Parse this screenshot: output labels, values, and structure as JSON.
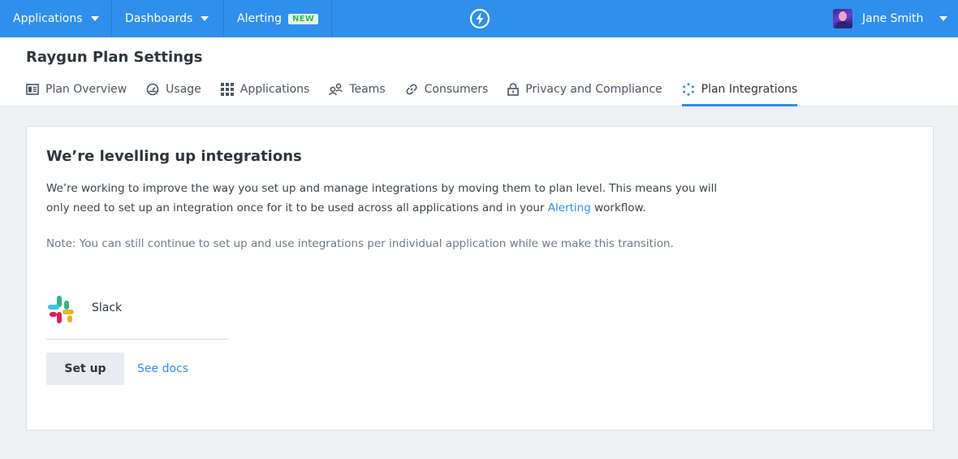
{
  "topnav": {
    "applications_label": "Applications",
    "dashboards_label": "Dashboards",
    "alerting_label": "Alerting",
    "alerting_badge": "NEW",
    "logo_icon": "lightning-bolt-icon",
    "user_name": "Jane Smith"
  },
  "header": {
    "title": "Raygun Plan Settings",
    "tabs": [
      {
        "label": "Plan Overview",
        "icon": "plan-overview-icon"
      },
      {
        "label": "Usage",
        "icon": "gauge-icon"
      },
      {
        "label": "Applications",
        "icon": "grid-icon"
      },
      {
        "label": "Teams",
        "icon": "team-icon"
      },
      {
        "label": "Consumers",
        "icon": "link-icon"
      },
      {
        "label": "Privacy and Compliance",
        "icon": "lock-icon"
      },
      {
        "label": "Plan Integrations",
        "icon": "integrations-icon",
        "active": true
      }
    ]
  },
  "card": {
    "title": "We’re levelling up integrations",
    "desc_part1": "We’re working to improve the way you set up and manage integrations by moving them to plan level. This means you will only need to set up an integration once for it to be used across all applications and in your ",
    "desc_link": "Alerting",
    "desc_part2": " workflow.",
    "note": "Note: You can still continue to set up and use integrations per individual application while we make this transition.",
    "integration": {
      "name": "Slack",
      "icon": "slack-logo-icon"
    },
    "setup_label": "Set up",
    "docs_label": "See docs"
  },
  "colors": {
    "brand": "#2f8fec",
    "badge_bg": "#e5f8e9",
    "badge_text": "#3cb35a"
  }
}
